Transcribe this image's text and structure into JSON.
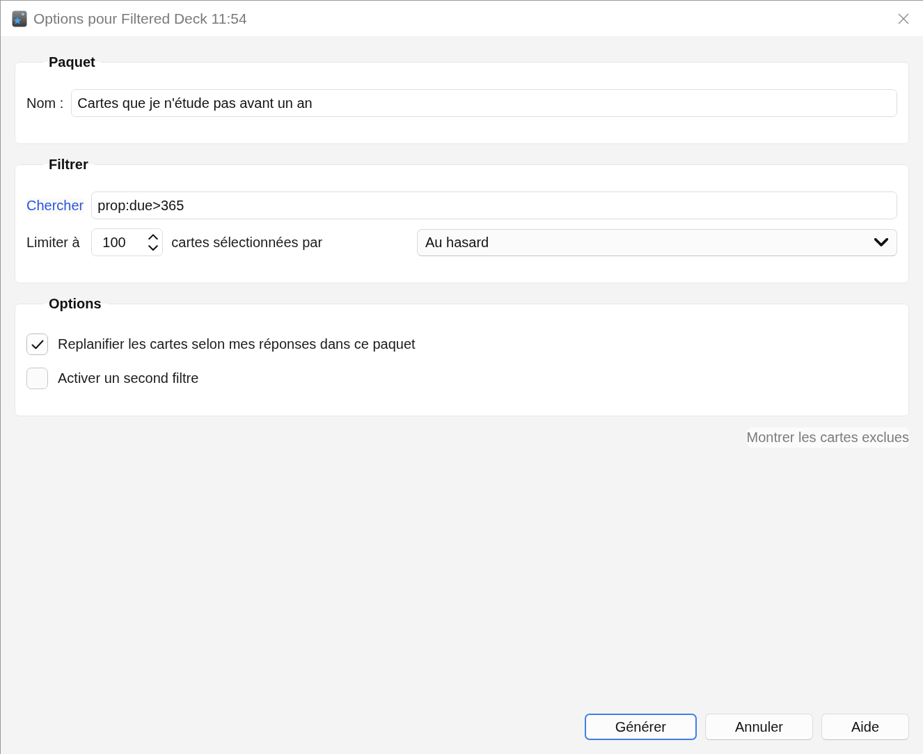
{
  "window": {
    "title": "Options pour Filtered Deck 11:54"
  },
  "deck": {
    "title": "Paquet",
    "name_label": "Nom :",
    "name_value": "Cartes que je n'étude pas avant un an"
  },
  "filter": {
    "title": "Filtrer",
    "search_label": "Chercher",
    "search_value": "prop:due>365",
    "limit_label": "Limiter à",
    "limit_value": "100",
    "order_label": "cartes sélectionnées par",
    "order_value": "Au hasard"
  },
  "options": {
    "title": "Options",
    "checkboxes": [
      {
        "label": "Replanifier les cartes selon mes réponses dans ce paquet",
        "checked": true
      },
      {
        "label": "Activer un second filtre",
        "checked": false
      }
    ]
  },
  "show_excluded": {
    "label": "Montrer les cartes exclues",
    "disabled": true
  },
  "buttons": [
    {
      "label": "Générer",
      "default": true
    },
    {
      "label": "Annuler",
      "default": false
    },
    {
      "label": "Aide",
      "default": false
    }
  ]
}
